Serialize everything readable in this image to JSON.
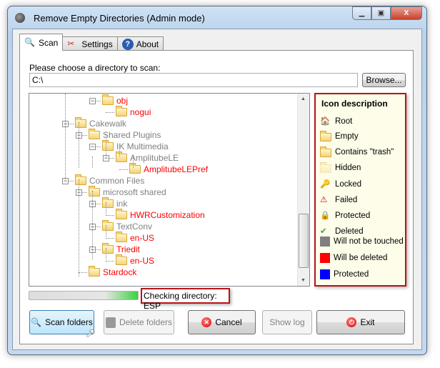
{
  "window": {
    "title": "Remove Empty Directories (Admin mode)",
    "min_icon": "minimize-icon",
    "max_icon": "maximize-icon",
    "close_icon": "close-icon"
  },
  "tabs": [
    {
      "label": "Scan",
      "icon": "magnifier-icon",
      "active": true
    },
    {
      "label": "Settings",
      "icon": "tools-icon"
    },
    {
      "label": "About",
      "icon": "help-icon"
    }
  ],
  "scan": {
    "dir_label": "Please choose a directory to scan:",
    "dir_value": "C:\\",
    "browse_label": "Browse...",
    "tree": [
      {
        "label": "obj",
        "level": 3,
        "status": "deleted",
        "expander": true
      },
      {
        "label": "nogui",
        "level": 4,
        "status": "deleted"
      },
      {
        "label": "Cakewalk",
        "level": 1,
        "status": "untouched",
        "expander": true
      },
      {
        "label": "Shared Plugins",
        "level": 2,
        "status": "untouched",
        "expander": true
      },
      {
        "label": "IK Multimedia",
        "level": 3,
        "status": "untouched",
        "expander": true
      },
      {
        "label": "AmplitubeLE",
        "level": 4,
        "status": "untouched",
        "expander": true
      },
      {
        "label": "AmplitubeLEPref",
        "level": 5,
        "status": "deleted"
      },
      {
        "label": "Common Files",
        "level": 1,
        "status": "untouched",
        "expander": true
      },
      {
        "label": "microsoft shared",
        "level": 2,
        "status": "untouched",
        "expander": true
      },
      {
        "label": "ink",
        "level": 3,
        "status": "untouched",
        "expander": true
      },
      {
        "label": "HWRCustomization",
        "level": 4,
        "status": "deleted"
      },
      {
        "label": "TextConv",
        "level": 3,
        "status": "untouched",
        "expander": true
      },
      {
        "label": "en-US",
        "level": 4,
        "status": "deleted"
      },
      {
        "label": "Triedit",
        "level": 3,
        "status": "deleted",
        "expander": true
      },
      {
        "label": "en-US",
        "level": 4,
        "status": "deleted"
      },
      {
        "label": "Stardock",
        "level": 2,
        "status": "deleted"
      }
    ],
    "legend": {
      "title": "Icon description",
      "items": [
        {
          "label": "Root",
          "icon": "home-icon"
        },
        {
          "label": "Empty",
          "icon": "folder-icon"
        },
        {
          "label": "Contains \"trash\"",
          "icon": "folder-trash-icon"
        },
        {
          "label": "Hidden",
          "icon": "hidden-folder-icon"
        },
        {
          "label": "Locked",
          "icon": "locked-folder-icon"
        },
        {
          "label": "Failed",
          "icon": "warning-icon"
        },
        {
          "label": "Protected",
          "icon": "lock-icon"
        },
        {
          "label": "Deleted",
          "icon": "checkmark-icon"
        }
      ],
      "colors": [
        {
          "label": "Will not be touched",
          "color": "#808080"
        },
        {
          "label": "Will be deleted",
          "color": "#ff0000"
        },
        {
          "label": "Protected",
          "color": "#0000ff"
        }
      ]
    },
    "progress_percent": 100,
    "status_text": "Checking directory: ESP",
    "buttons": {
      "scan": "Scan folders",
      "delete": "Delete folders",
      "cancel": "Cancel",
      "show_log": "Show log",
      "exit": "Exit"
    }
  },
  "colors": {
    "deleted": "#ff0000",
    "untouched": "#808080",
    "highlight": "#b5141b"
  }
}
